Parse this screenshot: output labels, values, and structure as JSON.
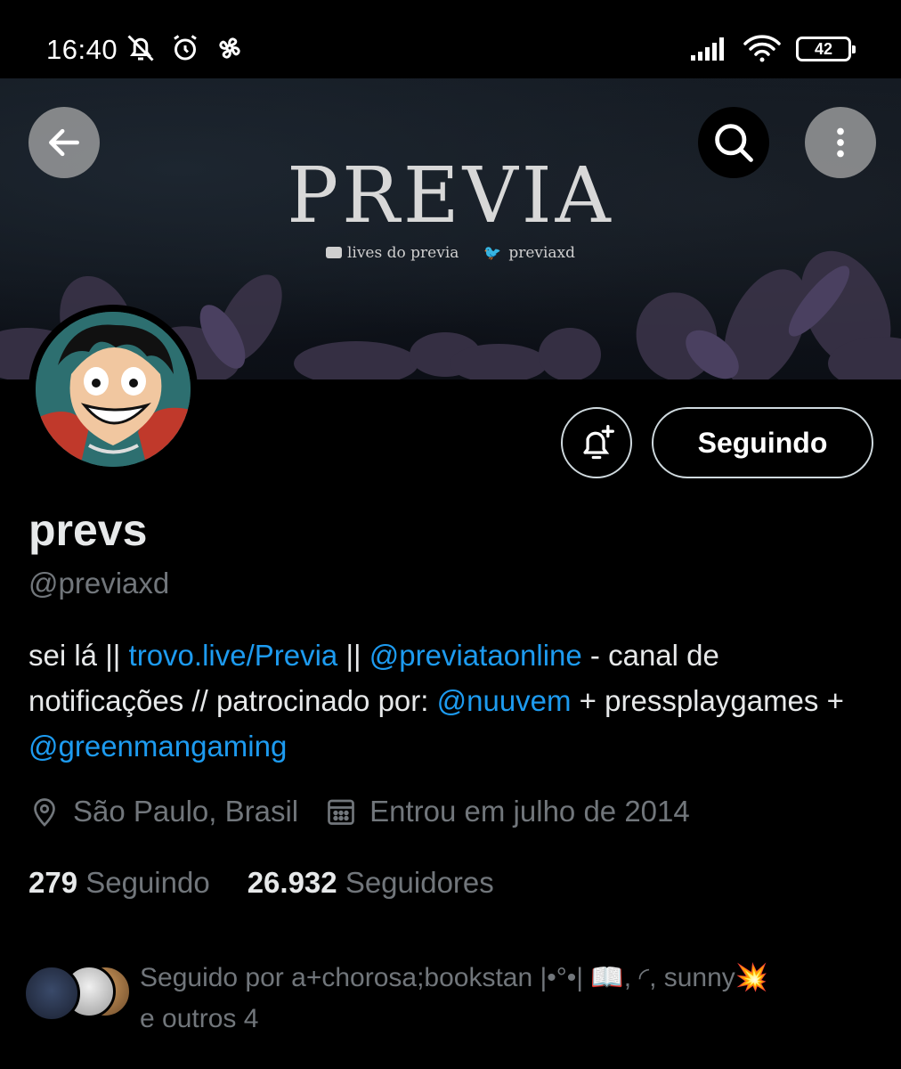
{
  "status_bar": {
    "time": "16:40",
    "icons": [
      "mute-icon",
      "alarm-icon",
      "fan-icon"
    ],
    "right_icons": [
      "signal-icon",
      "wifi-icon",
      "battery-icon"
    ],
    "battery": "42"
  },
  "banner": {
    "title": "PREVIA",
    "sub_youtube": "lives do previa",
    "sub_twitter": "previaxd"
  },
  "header_buttons": [
    "back-arrow-icon",
    "search-icon",
    "more-vertical-icon"
  ],
  "profile": {
    "follow_label": "Seguindo",
    "display_name": "prevs",
    "handle": "@previaxd",
    "bio": {
      "t1": "sei lá || ",
      "l1": "trovo.live/Previa",
      "t2": " || ",
      "l2": "@previataonline",
      "t3": " - canal de notificações // patrocinado por: ",
      "l3": "@nuuvem",
      "t4": " + pressplaygames + ",
      "l4": "@greenmangaming"
    },
    "location": "São Paulo, Brasil",
    "joined": "Entrou em julho de 2014",
    "following_count": "279",
    "following_label": "Seguindo",
    "followers_count": "26.932",
    "followers_label": "Seguidores",
    "followed_by_prefix": "Seguido por ",
    "followed_by_names": "a+chorosa;bookstan |•°•| 📖, ◜, sunny💥",
    "followed_by_more": "e outros 4"
  },
  "colors": {
    "background": "#000000",
    "text": "#e7e9ea",
    "secondary": "#71767b",
    "link": "#1d9bf0"
  }
}
